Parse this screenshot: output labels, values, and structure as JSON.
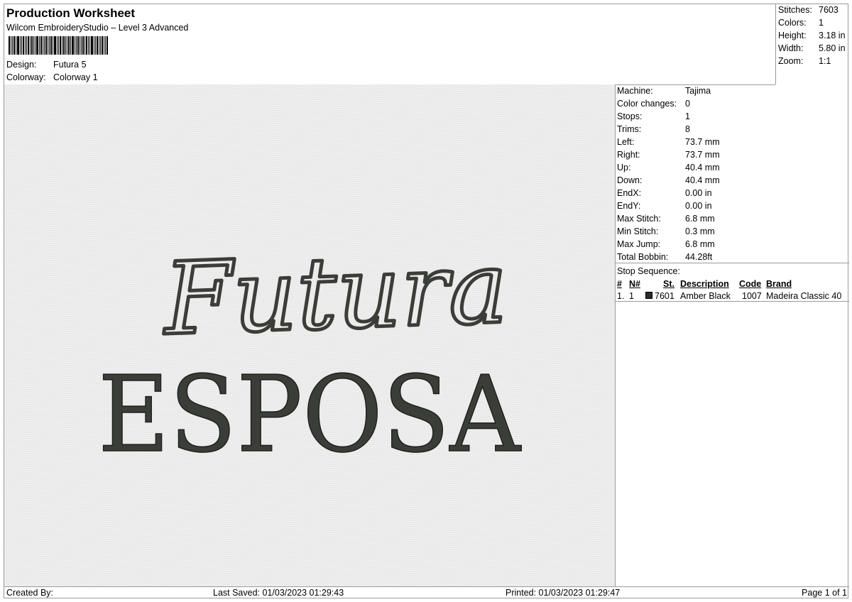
{
  "header": {
    "title": "Production Worksheet",
    "subtitle": "Wilcom EmbroideryStudio – Level 3 Advanced",
    "design_label": "Design:",
    "design_value": "Futura 5",
    "colorway_label": "Colorway:",
    "colorway_value": "Colorway 1"
  },
  "summary": [
    {
      "label": "Stitches:",
      "value": "7603"
    },
    {
      "label": "Colors:",
      "value": "1"
    },
    {
      "label": "Height:",
      "value": "3.18 in"
    },
    {
      "label": "Width:",
      "value": "5.80 in"
    },
    {
      "label": "Zoom:",
      "value": "1:1"
    }
  ],
  "details": [
    {
      "label": "Machine:",
      "value": "Tajima"
    },
    {
      "label": "Color changes:",
      "value": "0"
    },
    {
      "label": "Stops:",
      "value": "1"
    },
    {
      "label": "Trims:",
      "value": "8"
    },
    {
      "label": "Left:",
      "value": "73.7 mm"
    },
    {
      "label": "Right:",
      "value": "73.7 mm"
    },
    {
      "label": "Up:",
      "value": "40.4 mm"
    },
    {
      "label": "Down:",
      "value": "40.4 mm"
    },
    {
      "label": "EndX:",
      "value": "0.00 in"
    },
    {
      "label": "EndY:",
      "value": "0.00 in"
    },
    {
      "label": "Max Stitch:",
      "value": "6.8 mm"
    },
    {
      "label": "Min Stitch:",
      "value": "0.3 mm"
    },
    {
      "label": "Max Jump:",
      "value": "6.8 mm"
    },
    {
      "label": "Total Bobbin:",
      "value": "44.28ft"
    }
  ],
  "stop_sequence": {
    "title": "Stop Sequence:",
    "headers": {
      "num": "#",
      "n": "N#",
      "st": "St.",
      "description": "Description",
      "code": "Code",
      "brand": "Brand"
    },
    "rows": [
      {
        "num": "1.",
        "n": "1",
        "color": "#2a2a2a",
        "st": "7601",
        "description": "Amber Black",
        "code": "1007",
        "brand": "Madeira Classic 40"
      }
    ]
  },
  "design_text": {
    "script_word": "Futura",
    "serif_word": "ESPOSA",
    "thread_color": "#3b3d38"
  },
  "footer": {
    "created_by": "Created By:",
    "last_saved": "Last Saved: 01/03/2023 01:29:43",
    "printed": "Printed: 01/03/2023 01:29:47",
    "page": "Page 1 of 1"
  }
}
